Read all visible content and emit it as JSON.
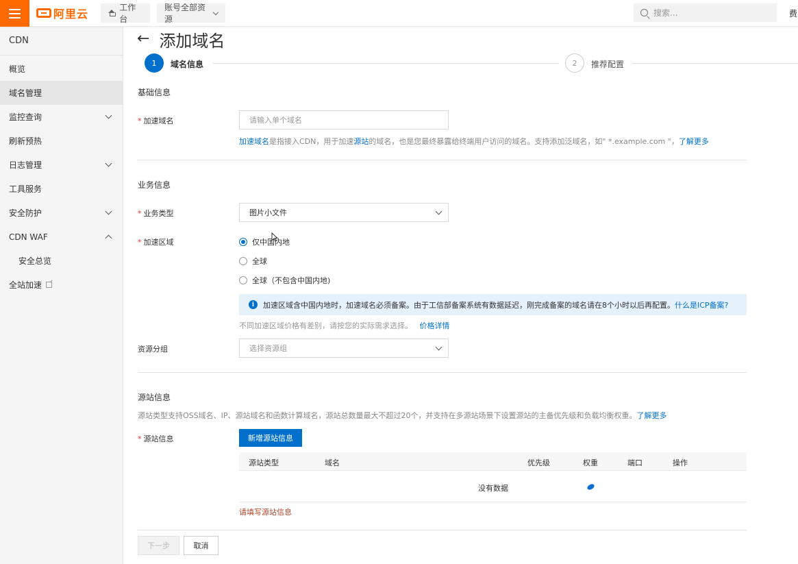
{
  "topbar": {
    "logo_text": "阿里云",
    "workbench_label": "工作台",
    "resource_label": "账号全部资源",
    "search_placeholder": "搜索...",
    "user_text": "费"
  },
  "sidebar": {
    "title": "CDN",
    "items": [
      {
        "label": "概览"
      },
      {
        "label": "域名管理"
      },
      {
        "label": "监控查询"
      },
      {
        "label": "刷新预热"
      },
      {
        "label": "日志管理"
      },
      {
        "label": "工具服务"
      },
      {
        "label": "安全防护"
      },
      {
        "label": "CDN WAF"
      },
      {
        "label": "安全总览"
      },
      {
        "label": "全站加速"
      }
    ]
  },
  "page": {
    "back_arrow": "←",
    "title": "添加域名"
  },
  "steps": [
    {
      "number": "1",
      "label": "域名信息"
    },
    {
      "number": "2",
      "label": "推荐配置"
    }
  ],
  "basic": {
    "section_title": "基础信息",
    "domain_label": "加速域名",
    "required_mark": "*",
    "domain_placeholder": "请输入单个域名",
    "help_link": "加速域名",
    "help_text_a": "是指接入CDN，用于加速",
    "help_link_origin": "源站",
    "help_text_b": "的域名，也是您最终暴露给终端用户访问的域名。支持添加泛域名，如\" *.example.com \"，",
    "help_more": "了解更多"
  },
  "business": {
    "section_title": "业务信息",
    "type_label": "业务类型",
    "type_value": "图片小文件",
    "region_label": "加速区域",
    "region_options": [
      {
        "label": "仅中国内地",
        "checked": true
      },
      {
        "label": "全球",
        "checked": false
      },
      {
        "label": "全球（不包含中国内地)",
        "checked": false
      }
    ],
    "notice_icon": "i",
    "notice_text": "加速区域含中国内地时，加速域名必须备案。由于工信部备案系统有数据延迟，刚完成备案的域名请在8个小时以后再配置。",
    "notice_link": "什么是ICP备案?",
    "price_text": "不同加速区域价格有差别，请按您的实际需求选择。",
    "price_link": "价格详情",
    "group_label": "资源分组",
    "group_placeholder": "选择资源组"
  },
  "origin": {
    "section_title": "源站信息",
    "desc": "源站类型支持OSS域名、IP、源站域名和函数计算域名，源站总数量最大不超过20个，并支持在多源站场景下设置源站的主备优先级和负载均衡权重。",
    "desc_link": "了解更多",
    "field_label": "源站信息",
    "add_button": "新增源站信息",
    "columns": [
      "源站类型",
      "域名",
      "优先级",
      "权重",
      "端口",
      "操作"
    ],
    "empty_text": "没有数据",
    "error_text": "请填写源站信息"
  },
  "footer": {
    "next_button": "下一步",
    "cancel_button": "取消"
  },
  "colors": {
    "brand_orange": "#ff6a00",
    "primary_blue": "#0070cc",
    "notice_bg": "#e5f1fb"
  }
}
